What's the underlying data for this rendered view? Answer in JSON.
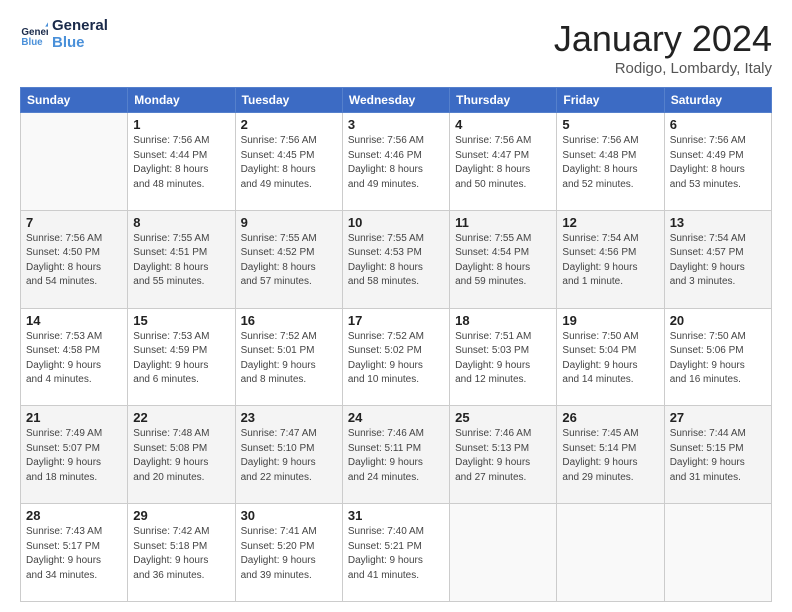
{
  "header": {
    "logo_general": "General",
    "logo_blue": "Blue",
    "month": "January 2024",
    "location": "Rodigo, Lombardy, Italy"
  },
  "weekdays": [
    "Sunday",
    "Monday",
    "Tuesday",
    "Wednesday",
    "Thursday",
    "Friday",
    "Saturday"
  ],
  "weeks": [
    [
      {
        "day": "",
        "info": ""
      },
      {
        "day": "1",
        "info": "Sunrise: 7:56 AM\nSunset: 4:44 PM\nDaylight: 8 hours\nand 48 minutes."
      },
      {
        "day": "2",
        "info": "Sunrise: 7:56 AM\nSunset: 4:45 PM\nDaylight: 8 hours\nand 49 minutes."
      },
      {
        "day": "3",
        "info": "Sunrise: 7:56 AM\nSunset: 4:46 PM\nDaylight: 8 hours\nand 49 minutes."
      },
      {
        "day": "4",
        "info": "Sunrise: 7:56 AM\nSunset: 4:47 PM\nDaylight: 8 hours\nand 50 minutes."
      },
      {
        "day": "5",
        "info": "Sunrise: 7:56 AM\nSunset: 4:48 PM\nDaylight: 8 hours\nand 52 minutes."
      },
      {
        "day": "6",
        "info": "Sunrise: 7:56 AM\nSunset: 4:49 PM\nDaylight: 8 hours\nand 53 minutes."
      }
    ],
    [
      {
        "day": "7",
        "info": "Sunrise: 7:56 AM\nSunset: 4:50 PM\nDaylight: 8 hours\nand 54 minutes."
      },
      {
        "day": "8",
        "info": "Sunrise: 7:55 AM\nSunset: 4:51 PM\nDaylight: 8 hours\nand 55 minutes."
      },
      {
        "day": "9",
        "info": "Sunrise: 7:55 AM\nSunset: 4:52 PM\nDaylight: 8 hours\nand 57 minutes."
      },
      {
        "day": "10",
        "info": "Sunrise: 7:55 AM\nSunset: 4:53 PM\nDaylight: 8 hours\nand 58 minutes."
      },
      {
        "day": "11",
        "info": "Sunrise: 7:55 AM\nSunset: 4:54 PM\nDaylight: 8 hours\nand 59 minutes."
      },
      {
        "day": "12",
        "info": "Sunrise: 7:54 AM\nSunset: 4:56 PM\nDaylight: 9 hours\nand 1 minute."
      },
      {
        "day": "13",
        "info": "Sunrise: 7:54 AM\nSunset: 4:57 PM\nDaylight: 9 hours\nand 3 minutes."
      }
    ],
    [
      {
        "day": "14",
        "info": "Sunrise: 7:53 AM\nSunset: 4:58 PM\nDaylight: 9 hours\nand 4 minutes."
      },
      {
        "day": "15",
        "info": "Sunrise: 7:53 AM\nSunset: 4:59 PM\nDaylight: 9 hours\nand 6 minutes."
      },
      {
        "day": "16",
        "info": "Sunrise: 7:52 AM\nSunset: 5:01 PM\nDaylight: 9 hours\nand 8 minutes."
      },
      {
        "day": "17",
        "info": "Sunrise: 7:52 AM\nSunset: 5:02 PM\nDaylight: 9 hours\nand 10 minutes."
      },
      {
        "day": "18",
        "info": "Sunrise: 7:51 AM\nSunset: 5:03 PM\nDaylight: 9 hours\nand 12 minutes."
      },
      {
        "day": "19",
        "info": "Sunrise: 7:50 AM\nSunset: 5:04 PM\nDaylight: 9 hours\nand 14 minutes."
      },
      {
        "day": "20",
        "info": "Sunrise: 7:50 AM\nSunset: 5:06 PM\nDaylight: 9 hours\nand 16 minutes."
      }
    ],
    [
      {
        "day": "21",
        "info": "Sunrise: 7:49 AM\nSunset: 5:07 PM\nDaylight: 9 hours\nand 18 minutes."
      },
      {
        "day": "22",
        "info": "Sunrise: 7:48 AM\nSunset: 5:08 PM\nDaylight: 9 hours\nand 20 minutes."
      },
      {
        "day": "23",
        "info": "Sunrise: 7:47 AM\nSunset: 5:10 PM\nDaylight: 9 hours\nand 22 minutes."
      },
      {
        "day": "24",
        "info": "Sunrise: 7:46 AM\nSunset: 5:11 PM\nDaylight: 9 hours\nand 24 minutes."
      },
      {
        "day": "25",
        "info": "Sunrise: 7:46 AM\nSunset: 5:13 PM\nDaylight: 9 hours\nand 27 minutes."
      },
      {
        "day": "26",
        "info": "Sunrise: 7:45 AM\nSunset: 5:14 PM\nDaylight: 9 hours\nand 29 minutes."
      },
      {
        "day": "27",
        "info": "Sunrise: 7:44 AM\nSunset: 5:15 PM\nDaylight: 9 hours\nand 31 minutes."
      }
    ],
    [
      {
        "day": "28",
        "info": "Sunrise: 7:43 AM\nSunset: 5:17 PM\nDaylight: 9 hours\nand 34 minutes."
      },
      {
        "day": "29",
        "info": "Sunrise: 7:42 AM\nSunset: 5:18 PM\nDaylight: 9 hours\nand 36 minutes."
      },
      {
        "day": "30",
        "info": "Sunrise: 7:41 AM\nSunset: 5:20 PM\nDaylight: 9 hours\nand 39 minutes."
      },
      {
        "day": "31",
        "info": "Sunrise: 7:40 AM\nSunset: 5:21 PM\nDaylight: 9 hours\nand 41 minutes."
      },
      {
        "day": "",
        "info": ""
      },
      {
        "day": "",
        "info": ""
      },
      {
        "day": "",
        "info": ""
      }
    ]
  ]
}
